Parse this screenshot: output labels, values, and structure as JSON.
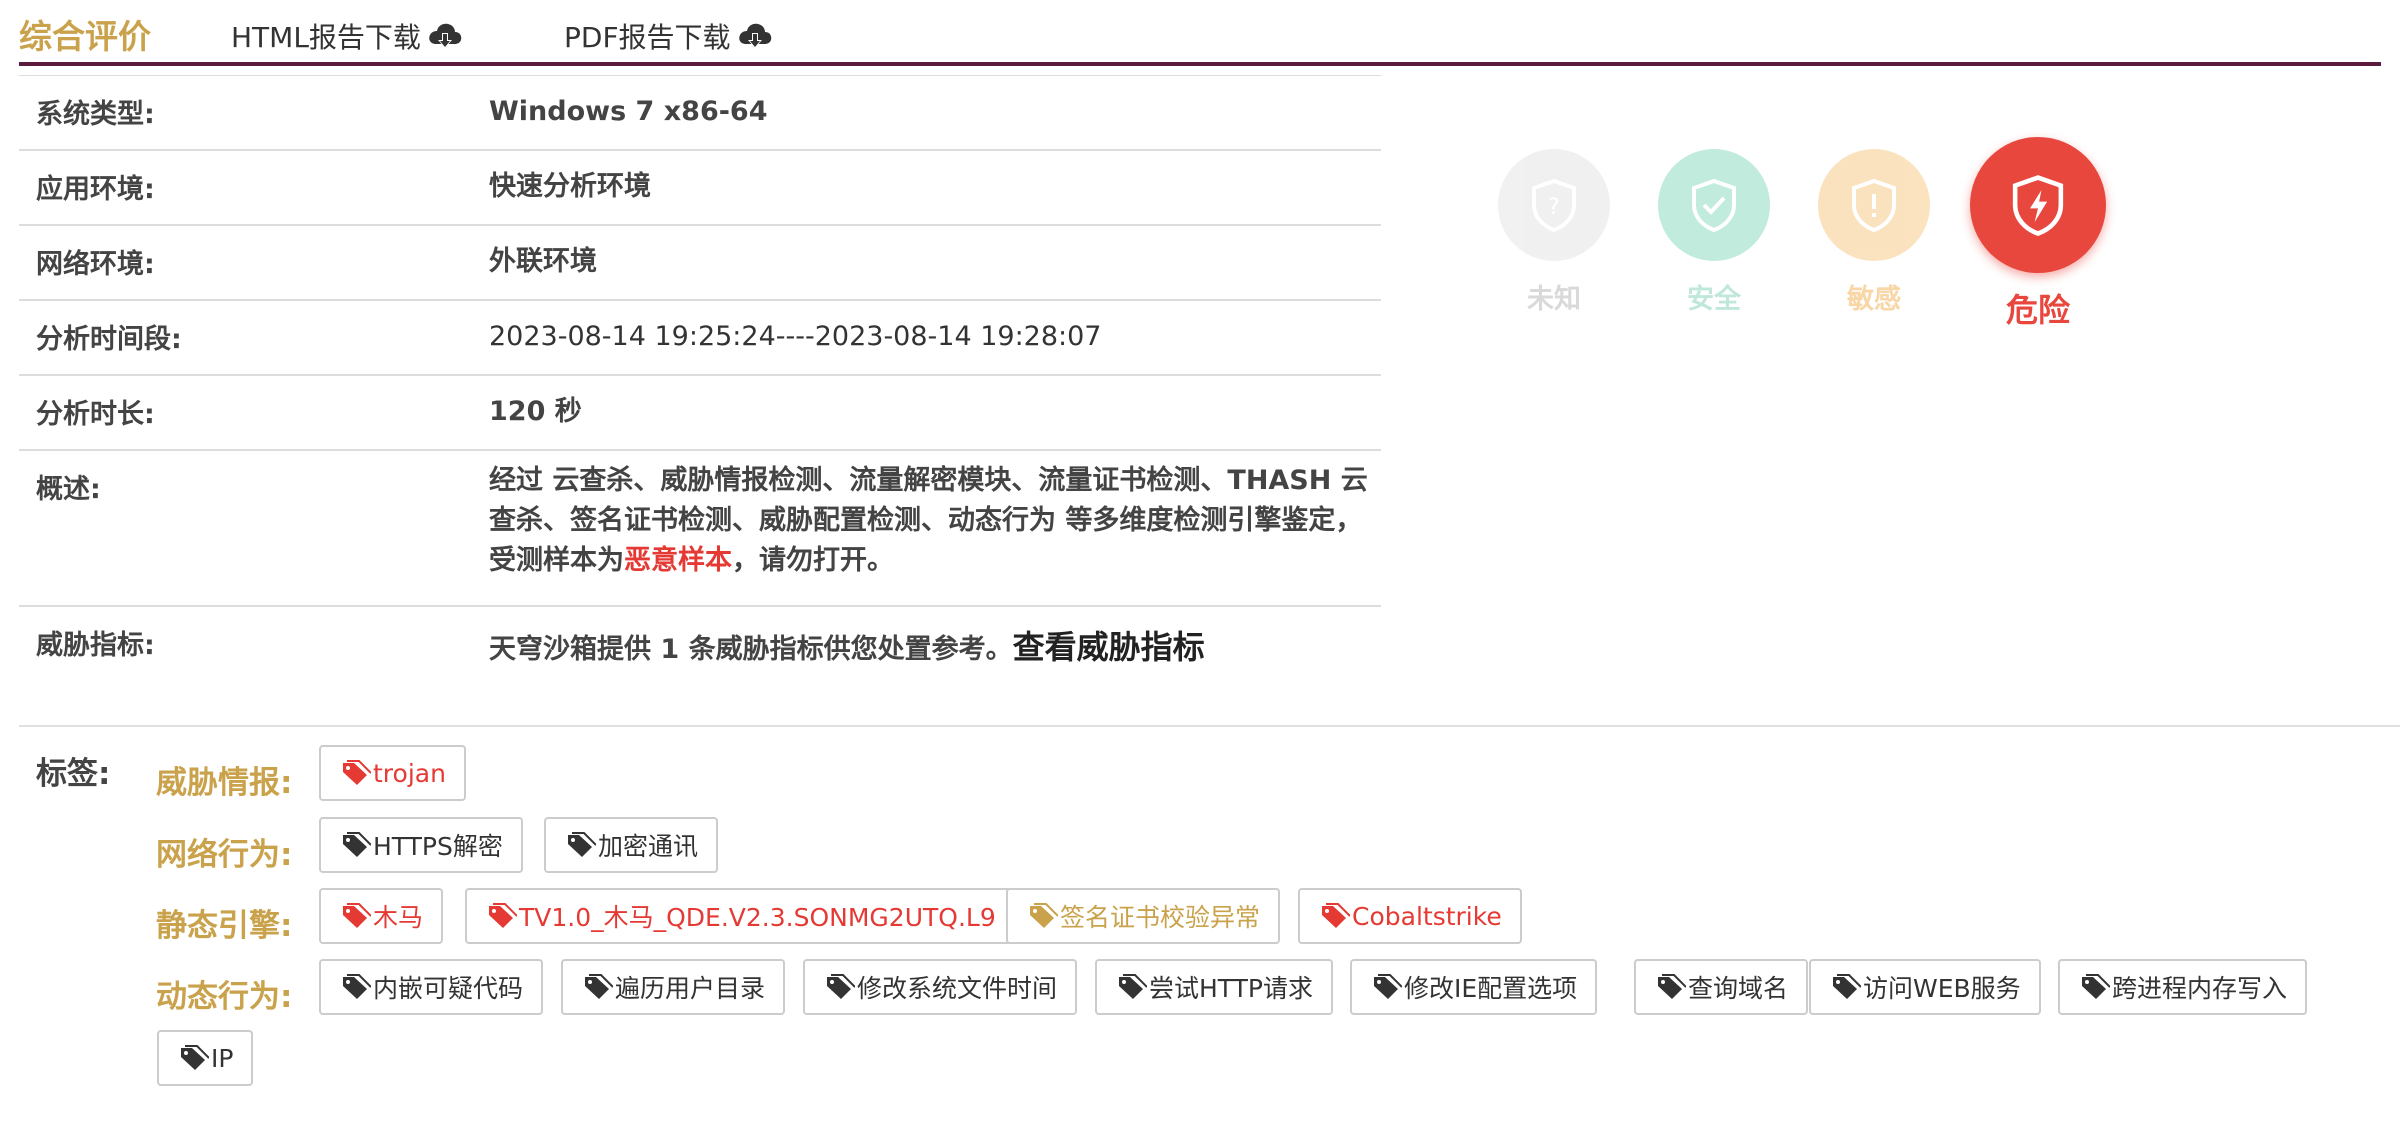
{
  "header": {
    "title": "综合评价",
    "html_download": "HTML报告下载",
    "pdf_download": "PDF报告下载"
  },
  "info": {
    "rows": [
      {
        "label": "系统类型:",
        "value": "Windows 7 x86-64"
      },
      {
        "label": "应用环境:",
        "value": "快速分析环境"
      },
      {
        "label": "网络环境:",
        "value": "外联环境"
      },
      {
        "label": "分析时间段:",
        "value": "2023-08-14 19:25:24----2023-08-14 19:28:07"
      },
      {
        "label": "分析时长:",
        "value": "120 秒"
      }
    ],
    "summary": {
      "label": "概述:",
      "text_before": "经过 云查杀、威胁情报检测、流量解密模块、流量证书检测、THASH 云查杀、签名证书检测、威胁配置检测、动态行为 等多维度检测引擎鉴定，受测样本为",
      "highlight": "恶意样本",
      "text_after": "，请勿打开。"
    },
    "indicators": {
      "label": "威胁指标:",
      "text": "天穹沙箱提供 1 条威胁指标供您处置参考。",
      "link": "查看威胁指标"
    }
  },
  "levels": [
    {
      "label": "未知",
      "color": "#d9d9d9",
      "active": false,
      "icon": "question-shield-icon"
    },
    {
      "label": "安全",
      "color": "#5cc7a4",
      "active": false,
      "icon": "check-shield-icon"
    },
    {
      "label": "敏感",
      "color": "#f5b25a",
      "active": false,
      "icon": "exclaim-shield-icon"
    },
    {
      "label": "危险",
      "color": "#e8473e",
      "active": true,
      "icon": "lightning-shield-icon"
    }
  ],
  "tags": {
    "label": "标签:",
    "categories": [
      {
        "label": "威胁情报:",
        "items": [
          "trojan"
        ]
      },
      {
        "label": "网络行为:",
        "items": [
          "HTTPS解密",
          "加密通讯"
        ]
      },
      {
        "label": "静态引擎:",
        "items": [
          "木马",
          "TV1.0_木马_QDE.V2.3.SONMG2UTQ.L9",
          "签名证书校验异常",
          "Cobaltstrike"
        ]
      },
      {
        "label": "动态行为:",
        "items": [
          "内嵌可疑代码",
          "遍历用户目录",
          "修改系统文件时间",
          "尝试HTTP请求",
          "修改IE配置选项",
          "查询域名",
          "访问WEB服务",
          "跨进程内存写入",
          "IP"
        ]
      }
    ]
  },
  "colors": {
    "accent": "#c9a24b",
    "header_line": "#5d1a3c",
    "danger": "#e53a34"
  }
}
